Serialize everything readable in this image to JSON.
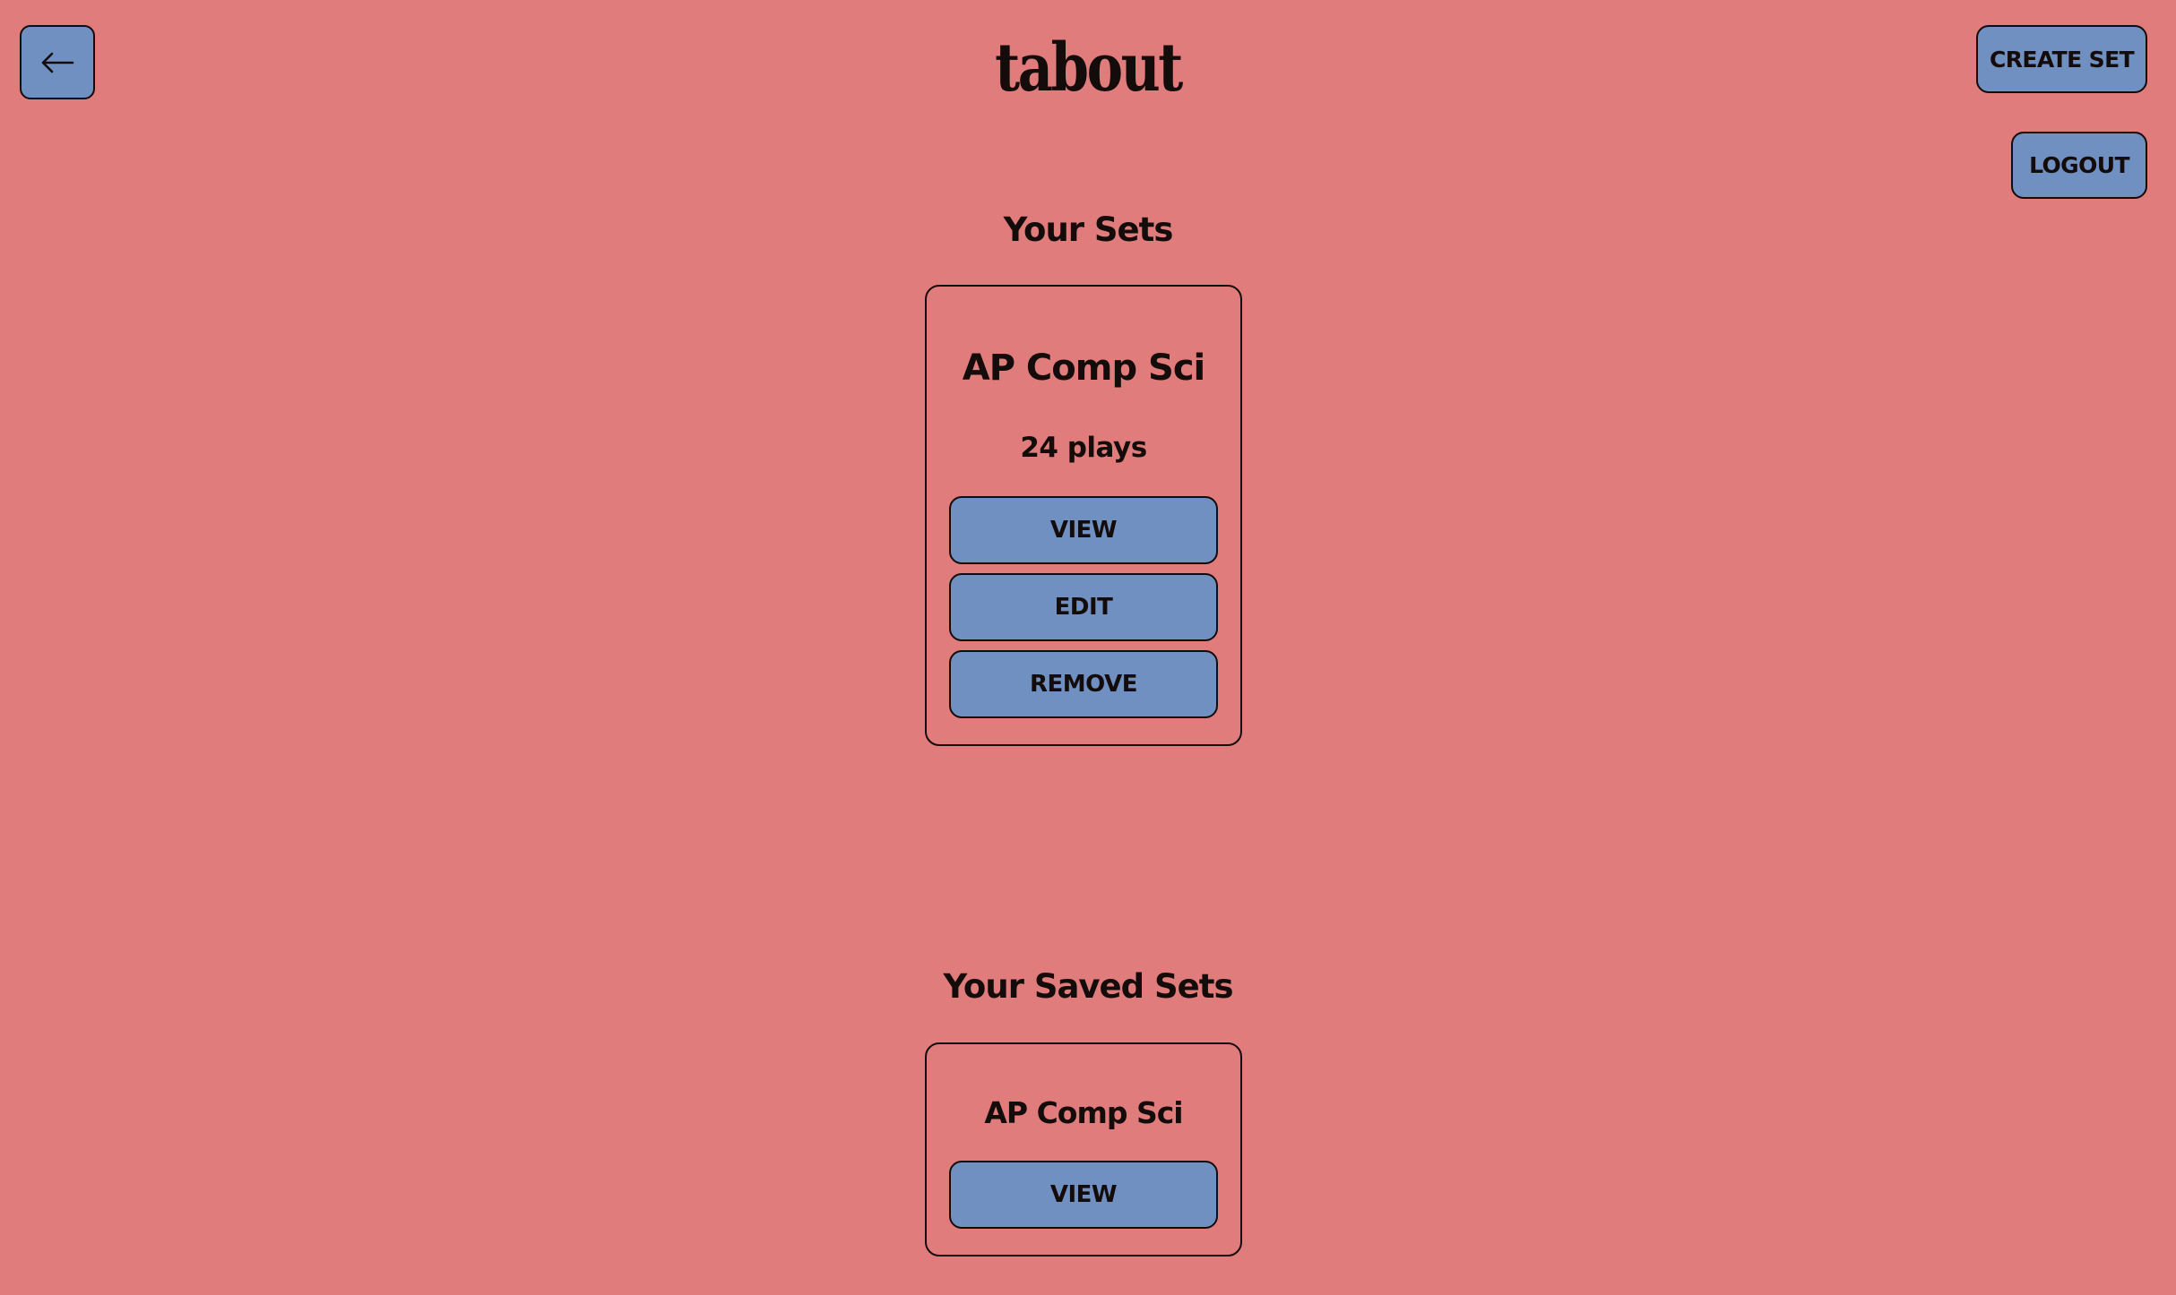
{
  "header": {
    "title": "tabout",
    "back_icon": "arrow-left-icon",
    "create_set_label": "CREATE SET",
    "logout_label": "LOGOUT"
  },
  "your_sets": {
    "title": "Your Sets",
    "items": [
      {
        "name": "AP Comp Sci",
        "plays": "24 plays",
        "view_label": "VIEW",
        "edit_label": "EDIT",
        "remove_label": "REMOVE"
      }
    ]
  },
  "saved_sets": {
    "title": "Your Saved Sets",
    "items": [
      {
        "name": "AP Comp Sci",
        "view_label": "VIEW"
      }
    ]
  },
  "colors": {
    "background": "#e07c7b",
    "button": "#6f90c0",
    "text": "#140c0a"
  }
}
